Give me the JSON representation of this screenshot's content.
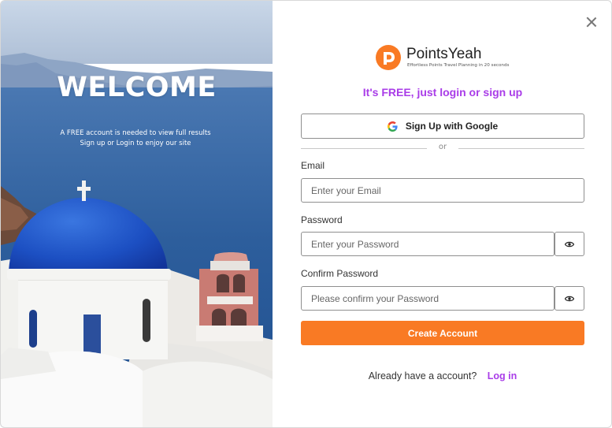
{
  "hero": {
    "title": "WELCOME",
    "subtitle_line1": "A FREE account is needed to view full results",
    "subtitle_line2": "Sign up or Login to enjoy our site"
  },
  "brand": {
    "name": "PointsYeah",
    "tagline": "Effortless Points Travel Planning in 20 seconds",
    "accent_color": "#f97a24",
    "highlight_color": "#a93ce8"
  },
  "form": {
    "headline": "It's FREE, just login or sign up",
    "google_button": "Sign Up with Google",
    "divider_text": "or",
    "email_label": "Email",
    "email_placeholder": "Enter your Email",
    "email_value": "",
    "password_label": "Password",
    "password_placeholder": "Enter your Password",
    "password_value": "",
    "confirm_label": "Confirm Password",
    "confirm_placeholder": "Please confirm your Password",
    "confirm_value": "",
    "submit_button": "Create Account",
    "footer_text": "Already have a account?",
    "login_link": "Log in"
  },
  "icons": {
    "close": "close-icon",
    "google": "google-icon",
    "eye": "eye-icon",
    "logo": "pointsyeah-logo-icon"
  }
}
